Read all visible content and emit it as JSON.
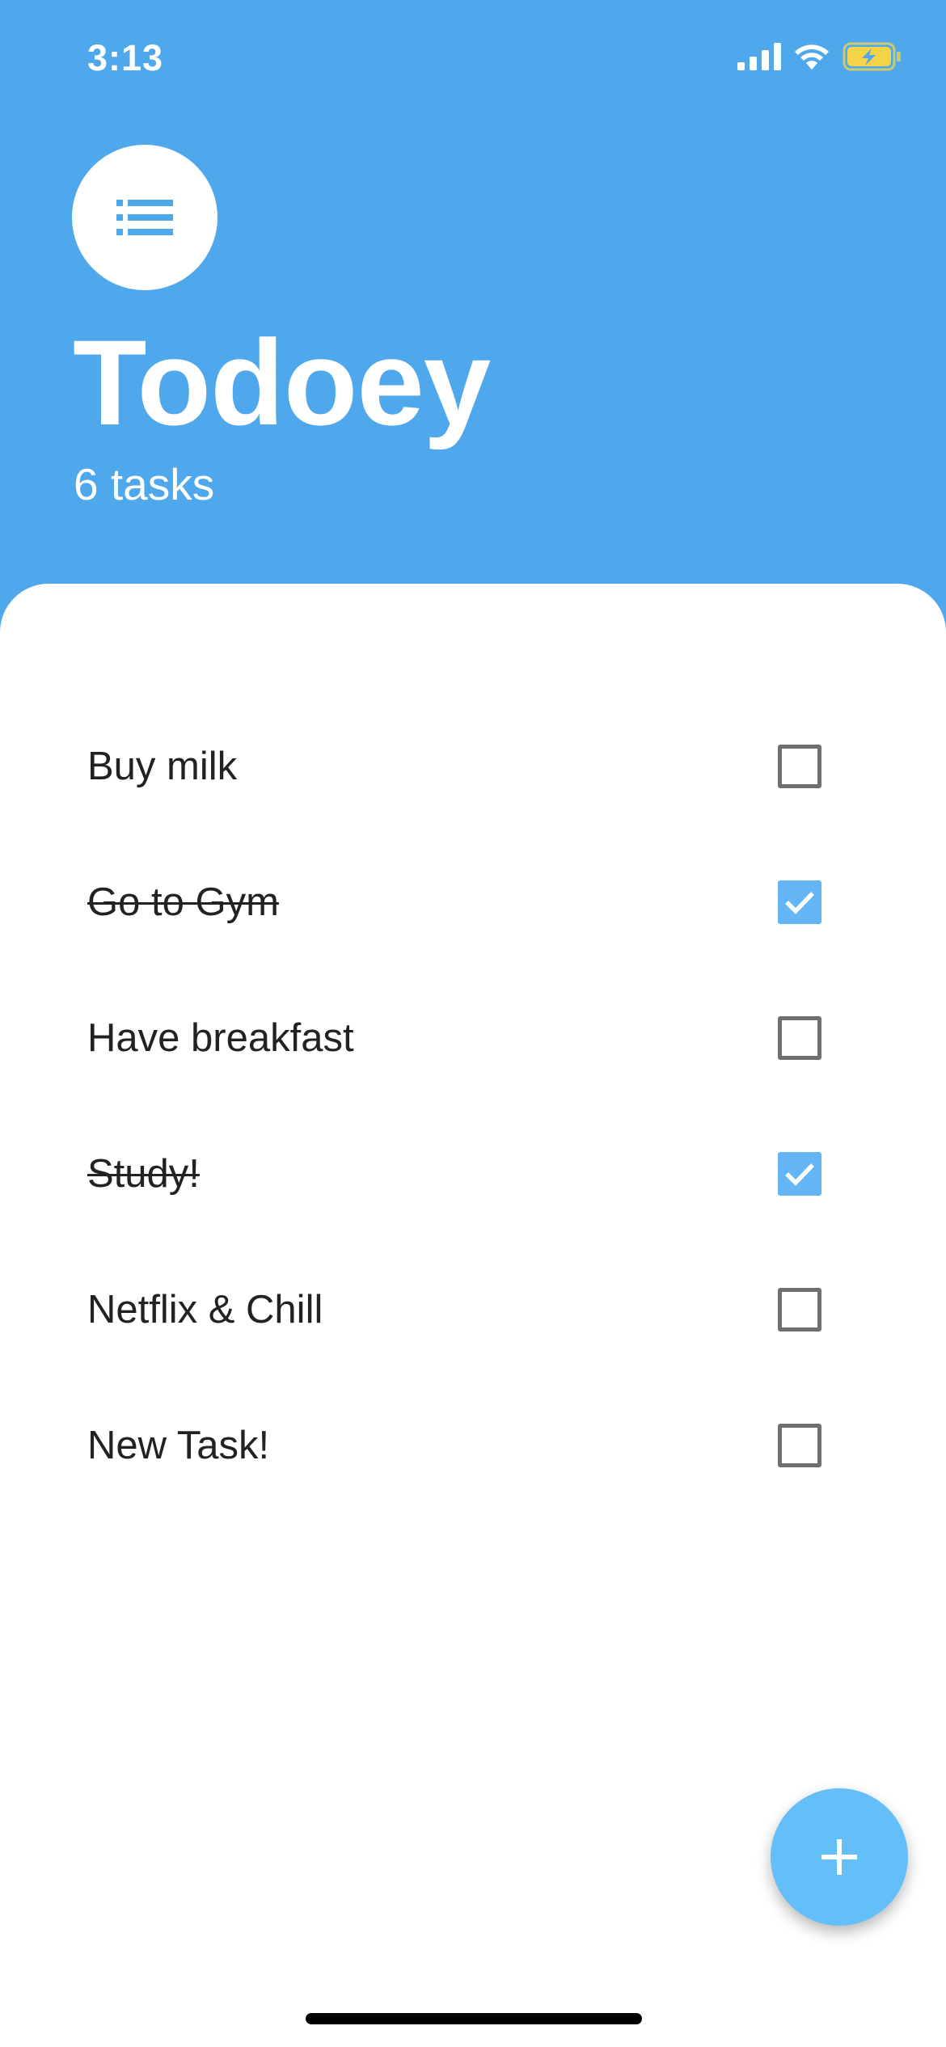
{
  "status_bar": {
    "time": "3:13",
    "icons": [
      "signal-icon",
      "wifi-icon",
      "battery-charging-icon"
    ]
  },
  "header": {
    "menu_icon": "list-icon",
    "title": "Todoey",
    "task_count": "6 tasks"
  },
  "tasks": [
    {
      "label": "Buy milk",
      "done": false
    },
    {
      "label": "Go to Gym",
      "done": true
    },
    {
      "label": "Have breakfast",
      "done": false
    },
    {
      "label": "Study!",
      "done": true
    },
    {
      "label": "Netflix & Chill",
      "done": false
    },
    {
      "label": "New Task!",
      "done": false
    }
  ],
  "fab": {
    "icon": "plus-icon"
  },
  "colors": {
    "primary": "#4FA7EC",
    "checkbox_checked": "#64B5F6",
    "fab": "#64BEF7",
    "battery": "#F5D547"
  }
}
